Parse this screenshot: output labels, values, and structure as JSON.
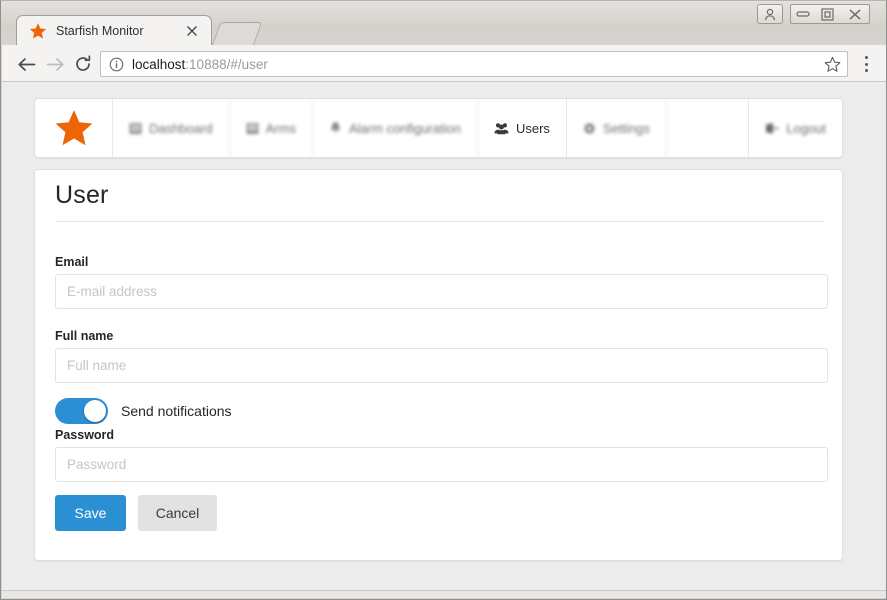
{
  "window": {
    "controls": [
      {
        "name": "user-account",
        "label": "User account"
      },
      {
        "name": "minimize",
        "label": "Minimize"
      },
      {
        "name": "maximize",
        "label": "Maximize"
      },
      {
        "name": "close",
        "label": "Close"
      }
    ]
  },
  "browser": {
    "tab": {
      "title": "Starfish Monitor",
      "favicon": "star-icon",
      "close_label": "×"
    },
    "new_tab_label": "",
    "toolbar": {
      "back": "back-arrow-icon",
      "forward": "forward-arrow-icon",
      "reload": "reload-icon",
      "info": "info-circle-icon",
      "bookmark": "star-outline-icon",
      "menu": "three-dot-menu-icon"
    },
    "url": {
      "host": "localhost",
      "rest": ":10888/#/user",
      "full": "localhost:10888/#/user"
    }
  },
  "app": {
    "brand_icon": "star-icon",
    "nav": [
      {
        "label": "Dashboard",
        "icon": "dashboard-icon",
        "active": false
      },
      {
        "label": "Arms",
        "icon": "list-icon",
        "active": false
      },
      {
        "label": "Alarm configuration",
        "icon": "bell-icon",
        "active": false
      },
      {
        "label": "Users",
        "icon": "users-icon",
        "active": true
      },
      {
        "label": "Settings",
        "icon": "gear-icon",
        "active": false
      },
      {
        "label": "Logout",
        "icon": "sign-out-icon",
        "active": false
      }
    ]
  },
  "page": {
    "title": "User",
    "fields": {
      "email": {
        "label": "Email",
        "placeholder": "E-mail address",
        "value": ""
      },
      "fullname": {
        "label": "Full name",
        "placeholder": "Full name",
        "value": ""
      },
      "password": {
        "label": "Password",
        "placeholder": "Password",
        "value": ""
      }
    },
    "toggle": {
      "label": "Send notifications",
      "on": true
    },
    "buttons": {
      "save": "Save",
      "cancel": "Cancel"
    }
  },
  "colors": {
    "accent": "#2b8fd4",
    "brand_orange": "#ec6608",
    "page_bg": "#ececec",
    "card_bg": "#ffffff",
    "muted_text": "#6f6f6f",
    "cancel_bg": "#e2e2e2"
  }
}
